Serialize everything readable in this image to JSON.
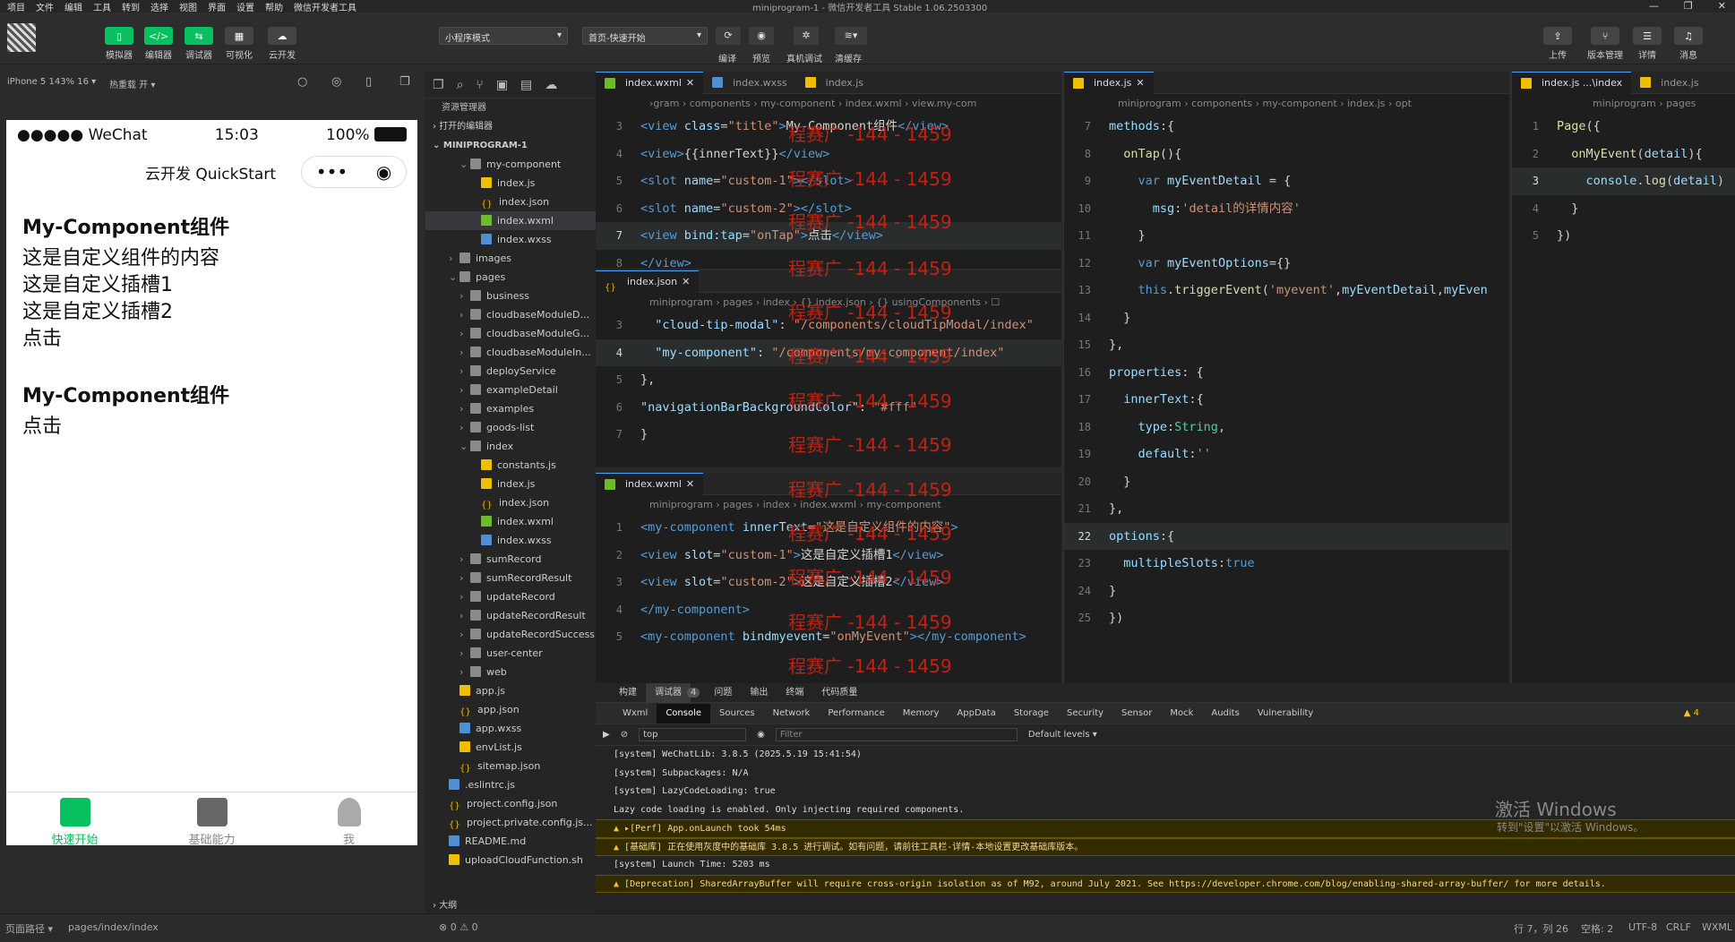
{
  "menu": [
    "项目",
    "文件",
    "编辑",
    "工具",
    "转到",
    "选择",
    "视图",
    "界面",
    "设置",
    "帮助",
    "微信开发者工具"
  ],
  "app_title": "miniprogram-1 - 微信开发者工具 Stable 1.06.2503300",
  "toolbar": {
    "simulator": "模拟器",
    "editor": "编辑器",
    "debugger": "调试器",
    "visual": "可视化",
    "cloud": "云开发",
    "mode": "小程序模式",
    "page": "首页-快速开始",
    "compile": "编译",
    "preview": "预览",
    "realdebug": "真机调试",
    "clearcache": "清缓存",
    "upload": "上传",
    "version": "版本管理",
    "detail": "详情",
    "message": "消息"
  },
  "sim": {
    "device": "iPhone 5 143% 16 ▾",
    "hotreload": "热重载 开 ▾"
  },
  "phone": {
    "carrier": "●●●●● WeChat",
    "time": "15:03",
    "battery": "100%",
    "nav_title": "云开发 QuickStart",
    "c1_title": "My-Component组件",
    "c1_text": "这是自定义组件的内容",
    "c1_slot1": "这是自定义插槽1",
    "c1_slot2": "这是自定义插槽2",
    "c1_tap": "点击",
    "c2_title": "My-Component组件",
    "c2_tap": "点击",
    "tab1": "快速开始",
    "tab2": "基础能力",
    "tab3": "我",
    "tab_active_color": "#07c160"
  },
  "explorer": {
    "title": "资源管理器",
    "open_editors": "打开的编辑器",
    "project": "MINIPROGRAM-1",
    "outline": "大纲",
    "rows": [
      {
        "d": 2,
        "t": "folder",
        "n": "my-component",
        "open": true
      },
      {
        "d": 3,
        "t": "js",
        "n": "index.js"
      },
      {
        "d": 3,
        "t": "json",
        "n": "index.json"
      },
      {
        "d": 3,
        "t": "wxml",
        "n": "index.wxml",
        "sel": true
      },
      {
        "d": 3,
        "t": "wxss",
        "n": "index.wxss"
      },
      {
        "d": 1,
        "t": "folder",
        "n": "images"
      },
      {
        "d": 1,
        "t": "folder",
        "n": "pages",
        "open": true
      },
      {
        "d": 2,
        "t": "folder",
        "n": "business"
      },
      {
        "d": 2,
        "t": "folder",
        "n": "cloudbaseModuleD..."
      },
      {
        "d": 2,
        "t": "folder",
        "n": "cloudbaseModuleG..."
      },
      {
        "d": 2,
        "t": "folder",
        "n": "cloudbaseModuleIn..."
      },
      {
        "d": 2,
        "t": "folder",
        "n": "deployService"
      },
      {
        "d": 2,
        "t": "folder",
        "n": "exampleDetail"
      },
      {
        "d": 2,
        "t": "folder",
        "n": "examples"
      },
      {
        "d": 2,
        "t": "folder",
        "n": "goods-list"
      },
      {
        "d": 2,
        "t": "folder",
        "n": "index",
        "open": true
      },
      {
        "d": 3,
        "t": "js",
        "n": "constants.js"
      },
      {
        "d": 3,
        "t": "js",
        "n": "index.js"
      },
      {
        "d": 3,
        "t": "json",
        "n": "index.json"
      },
      {
        "d": 3,
        "t": "wxml",
        "n": "index.wxml"
      },
      {
        "d": 3,
        "t": "wxss",
        "n": "index.wxss"
      },
      {
        "d": 2,
        "t": "folder",
        "n": "sumRecord"
      },
      {
        "d": 2,
        "t": "folder",
        "n": "sumRecordResult"
      },
      {
        "d": 2,
        "t": "folder",
        "n": "updateRecord"
      },
      {
        "d": 2,
        "t": "folder",
        "n": "updateRecordResult"
      },
      {
        "d": 2,
        "t": "folder",
        "n": "updateRecordSuccess"
      },
      {
        "d": 2,
        "t": "folder",
        "n": "user-center"
      },
      {
        "d": 2,
        "t": "folder",
        "n": "web"
      },
      {
        "d": 1,
        "t": "js",
        "n": "app.js"
      },
      {
        "d": 1,
        "t": "json",
        "n": "app.json"
      },
      {
        "d": 1,
        "t": "wxss",
        "n": "app.wxss"
      },
      {
        "d": 1,
        "t": "js",
        "n": "envList.js"
      },
      {
        "d": 1,
        "t": "json",
        "n": "sitemap.json"
      },
      {
        "d": 0,
        "t": "wxss",
        "n": ".eslintrc.js"
      },
      {
        "d": 0,
        "t": "json",
        "n": "project.config.json"
      },
      {
        "d": 0,
        "t": "json",
        "n": "project.private.config.js..."
      },
      {
        "d": 0,
        "t": "wxss",
        "n": "README.md"
      },
      {
        "d": 0,
        "t": "js",
        "n": "uploadCloudFunction.sh"
      }
    ]
  },
  "editors": {
    "e1": {
      "tab": "index.wxml",
      "tab2": "index.wxss",
      "tab3": "index.js",
      "crumb": "›gram › components › my-component › index.wxml › view.my-com"
    },
    "e2": {
      "tab": "index.json",
      "crumb": "miniprogram › pages › index › {} index.json › {} usingComponents › ☐"
    },
    "e3": {
      "tab": "index.wxml",
      "crumb": "miniprogram › pages › index › index.wxml › my-component"
    },
    "e4": {
      "tab": "index.js",
      "crumb": "miniprogram › components › my-component › index.js › opt"
    },
    "e5": {
      "tab": "index.js ...\\index",
      "tab2": "index.js",
      "crumb": "miniprogram › pages"
    }
  },
  "watermark": "程赛广 -144 - 1459",
  "console": {
    "tabs": [
      "构建",
      "调试器",
      "问题",
      "输出",
      "终端",
      "代码质量"
    ],
    "badge": "4",
    "subtabs": [
      "Wxml",
      "Console",
      "Sources",
      "Network",
      "Performance",
      "Memory",
      "AppData",
      "Storage",
      "Security",
      "Sensor",
      "Mock",
      "Audits",
      "Vulnerability"
    ],
    "warn_count": "▲ 4",
    "context": "top",
    "filter": "Filter",
    "levels": "Default levels ▾",
    "logs": [
      {
        "w": false,
        "t": "[system] WeChatLib: 3.8.5 (2025.5.19 15:41:54)"
      },
      {
        "w": false,
        "t": "[system] Subpackages: N/A"
      },
      {
        "w": false,
        "t": "[system] LazyCodeLoading: true"
      },
      {
        "w": false,
        "t": "Lazy code loading is enabled. Only injecting required components."
      },
      {
        "w": true,
        "t": "▸[Perf] App.onLaunch took 54ms"
      },
      {
        "w": true,
        "t": "[基础库] 正在使用灰度中的基础库 3.8.5 进行调试。如有问题，请前往工具栏-详情-本地设置更改基础库版本。"
      },
      {
        "w": false,
        "t": "[system] Launch Time: 5203 ms"
      },
      {
        "w": true,
        "t": "[Deprecation] SharedArrayBuffer will require cross-origin isolation as of M92, around July 2021. See https://developer.chrome.com/blog/enabling-shared-array-buffer/ for more details."
      }
    ],
    "activate1": "激活 Windows",
    "activate2": "转到\"设置\"以激活 Windows。"
  },
  "status": {
    "path_label": "页面路径 ▾",
    "path": "pages/index/index",
    "errors": "⊗ 0 ⚠ 0",
    "pos": "行 7，列 26",
    "spaces": "空格: 2",
    "enc": "UTF-8",
    "eol": "CRLF",
    "lang": "WXML"
  }
}
